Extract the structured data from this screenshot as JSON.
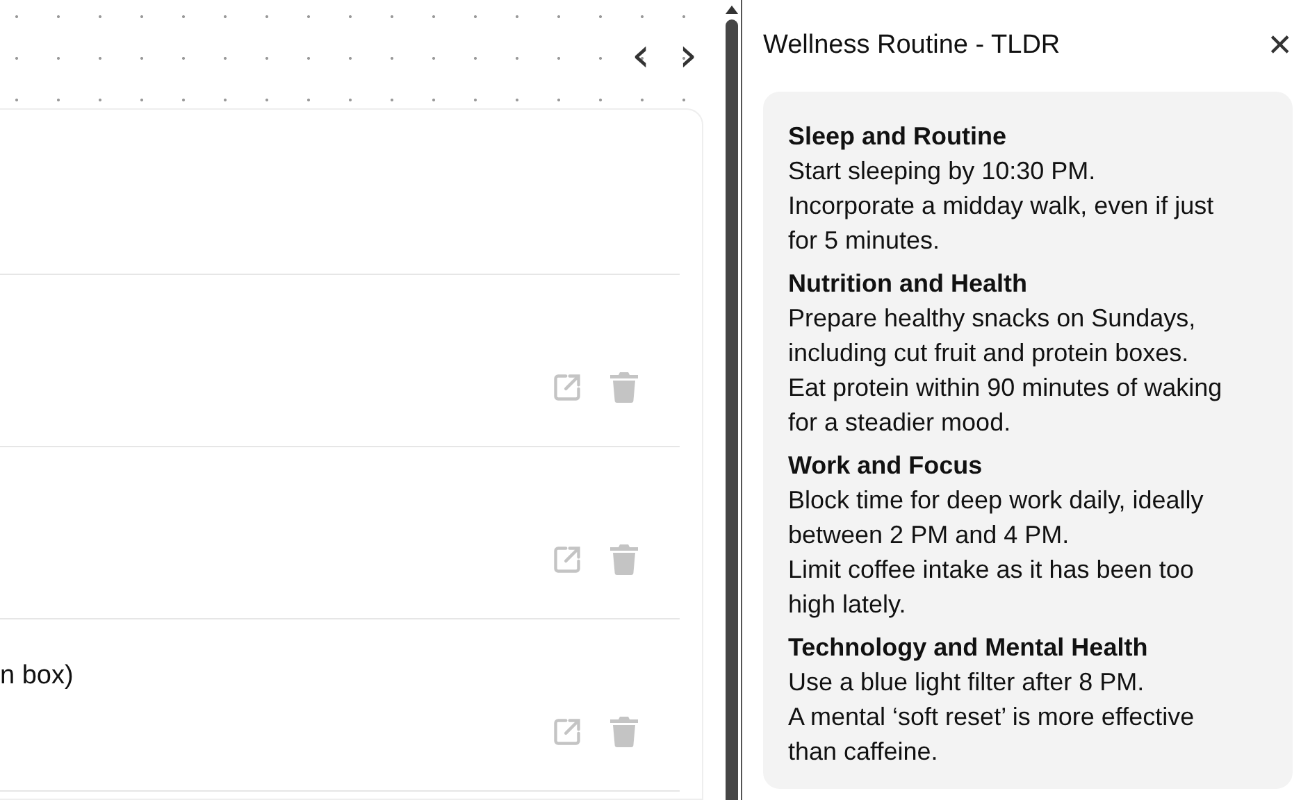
{
  "nav": {
    "prev": "‹",
    "next": "›"
  },
  "rows": [
    {
      "kind": "header"
    },
    {
      "kind": "entry"
    },
    {
      "kind": "entry"
    },
    {
      "kind": "entry",
      "text": "n box)"
    }
  ],
  "panel": {
    "title": "Wellness Routine - TLDR",
    "close": "✕",
    "sections": [
      {
        "heading": "Sleep and Routine",
        "lines": [
          "Start sleeping by 10:30 PM.",
          "Incorporate a midday walk, even if just for 5 minutes."
        ]
      },
      {
        "heading": "Nutrition and Health",
        "lines": [
          "Prepare healthy snacks on Sundays, including cut fruit and protein boxes.",
          "Eat protein within 90 minutes of waking for a steadier mood."
        ]
      },
      {
        "heading": "Work and Focus",
        "lines": [
          "Block time for deep work daily, ideally between 2 PM and 4 PM.",
          "Limit coffee intake as it has been too high lately."
        ]
      },
      {
        "heading": "Technology and Mental Health",
        "lines": [
          "Use a blue light filter after 8 PM.",
          "A mental ‘soft reset’ is more effective than caffeine."
        ]
      }
    ]
  }
}
